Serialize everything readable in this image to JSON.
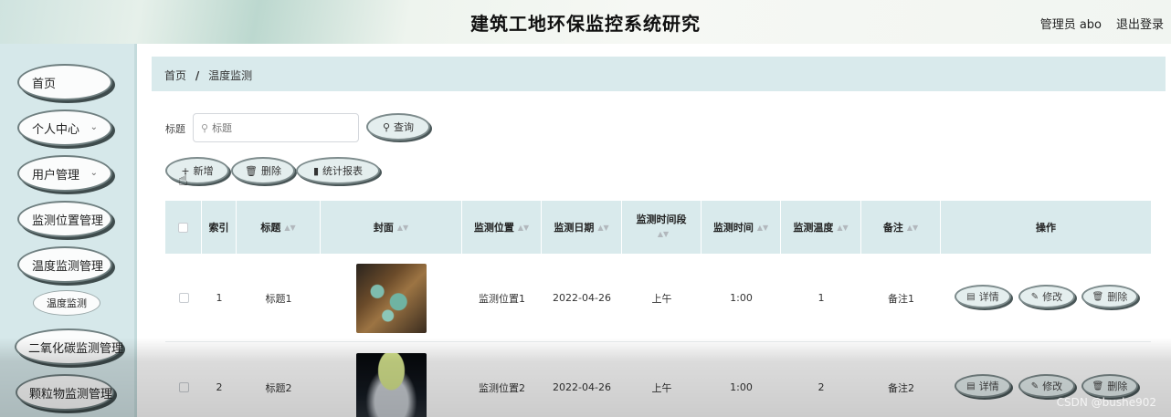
{
  "header": {
    "title": "建筑工地环保监控系统研究",
    "user": "管理员 abo",
    "logout": "退出登录"
  },
  "sidebar": {
    "items": [
      {
        "label": "首页",
        "chevron": false
      },
      {
        "label": "个人中心",
        "chevron": true
      },
      {
        "label": "用户管理",
        "chevron": true
      },
      {
        "label": "监测位置管理",
        "chevron": false
      },
      {
        "label": "温度监测管理",
        "chevron": false
      },
      {
        "label": "二氧化碳监测管理",
        "chevron": false
      },
      {
        "label": "颗粒物监测管理",
        "chevron": false
      }
    ],
    "sub_item": "温度监测"
  },
  "breadcrumb": {
    "home": "首页",
    "separator": "/",
    "current": "温度监测"
  },
  "search": {
    "label": "标题",
    "placeholder": "标题",
    "button": "查询"
  },
  "toolbar": {
    "add": "新增",
    "delete": "删除",
    "report": "统计报表"
  },
  "table": {
    "headers": {
      "index": "索引",
      "title": "标题",
      "cover": "封面",
      "location": "监测位置",
      "date": "监测日期",
      "period": "监测时间段",
      "time": "监测时间",
      "temperature": "监测温度",
      "remark": "备注",
      "actions": "操作"
    },
    "rows": [
      {
        "index": "1",
        "title": "标题1",
        "cover": "tea-set-photo",
        "location": "监测位置1",
        "date": "2022-04-26",
        "period": "上午",
        "time": "1:00",
        "temperature": "1",
        "remark": "备注1"
      },
      {
        "index": "2",
        "title": "标题2",
        "cover": "lamp-photo",
        "location": "监测位置2",
        "date": "2022-04-26",
        "period": "上午",
        "time": "1:00",
        "temperature": "2",
        "remark": "备注2"
      }
    ],
    "actions": {
      "detail": "详情",
      "edit": "修改",
      "delete": "删除"
    }
  },
  "watermark": "CSDN @bushe902"
}
